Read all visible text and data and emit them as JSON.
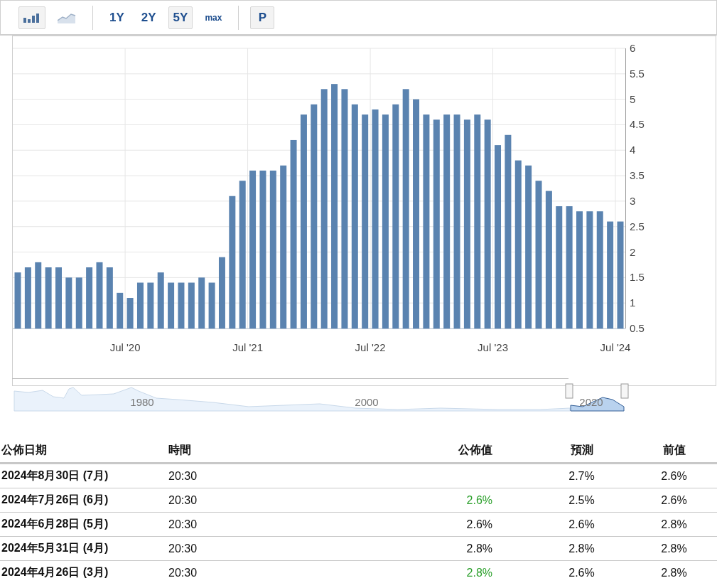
{
  "toolbar": {
    "chart_types": [
      {
        "kind": "bars",
        "selected": true
      },
      {
        "kind": "area",
        "selected": false
      }
    ],
    "periods": [
      {
        "label": "1Y",
        "selected": false
      },
      {
        "label": "2Y",
        "selected": false
      },
      {
        "label": "5Y",
        "selected": true
      },
      {
        "label": "max",
        "selected": false
      }
    ],
    "print_button": "P"
  },
  "chart": {
    "chart_data": {
      "type": "bar",
      "grid": true,
      "categories": [
        null,
        null,
        null,
        null,
        null,
        null,
        null,
        null,
        null,
        null,
        null,
        "Jul '20",
        null,
        null,
        null,
        null,
        null,
        null,
        null,
        null,
        null,
        null,
        null,
        "Jul '21",
        null,
        null,
        null,
        null,
        null,
        null,
        null,
        null,
        null,
        null,
        null,
        "Jul '22",
        null,
        null,
        null,
        null,
        null,
        null,
        null,
        null,
        null,
        null,
        null,
        "Jul '23",
        null,
        null,
        null,
        null,
        null,
        null,
        null,
        null,
        null,
        null,
        null,
        "Jul '24"
      ],
      "series": [
        {
          "color": "#5a83b0",
          "values": [
            1.6,
            1.7,
            1.8,
            1.7,
            1.7,
            1.5,
            1.5,
            1.7,
            1.8,
            1.7,
            1.2,
            1.1,
            1.4,
            1.4,
            1.6,
            1.4,
            1.4,
            1.4,
            1.5,
            1.4,
            1.9,
            3.1,
            3.4,
            3.6,
            3.6,
            3.6,
            3.7,
            4.2,
            4.7,
            4.9,
            5.2,
            5.3,
            5.2,
            4.9,
            4.7,
            4.8,
            4.7,
            4.9,
            5.2,
            5.0,
            4.7,
            4.6,
            4.7,
            4.7,
            4.6,
            4.7,
            4.6,
            4.1,
            4.3,
            3.8,
            3.7,
            3.4,
            3.2,
            2.9,
            2.9,
            2.8,
            2.8,
            2.8,
            2.6,
            2.6
          ]
        }
      ],
      "ylim": [
        0.5,
        6
      ],
      "yticks": [
        0.5,
        1,
        1.5,
        2,
        2.5,
        3,
        3.5,
        4,
        4.5,
        5,
        5.5,
        6
      ]
    },
    "navigator_labels": [
      "1980",
      "2000",
      "2020"
    ]
  },
  "table": {
    "columns": [
      "公佈日期",
      "時間",
      "公佈值",
      "預測",
      "前值"
    ],
    "rows": [
      {
        "date": "2024年8月30日 (7月)",
        "time": "20:30",
        "forecast": "2.7%",
        "previous": "2.6%"
      },
      {
        "date": "2024年7月26日 (6月)",
        "time": "20:30",
        "actual": "2.6%",
        "color": "#2ca02c",
        "forecast": "2.5%",
        "previous": "2.6%"
      },
      {
        "date": "2024年6月28日 (5月)",
        "time": "20:30",
        "actual": "2.6%",
        "color": "#111111",
        "forecast": "2.6%",
        "previous": "2.8%"
      },
      {
        "date": "2024年5月31日 (4月)",
        "time": "20:30",
        "actual": "2.8%",
        "color": "#111111",
        "forecast": "2.8%",
        "previous": "2.8%"
      },
      {
        "date": "2024年4月26日 (3月)",
        "time": "20:30",
        "actual": "2.8%",
        "color": "#2ca02c",
        "forecast": "2.6%",
        "previous": "2.8%"
      }
    ]
  }
}
